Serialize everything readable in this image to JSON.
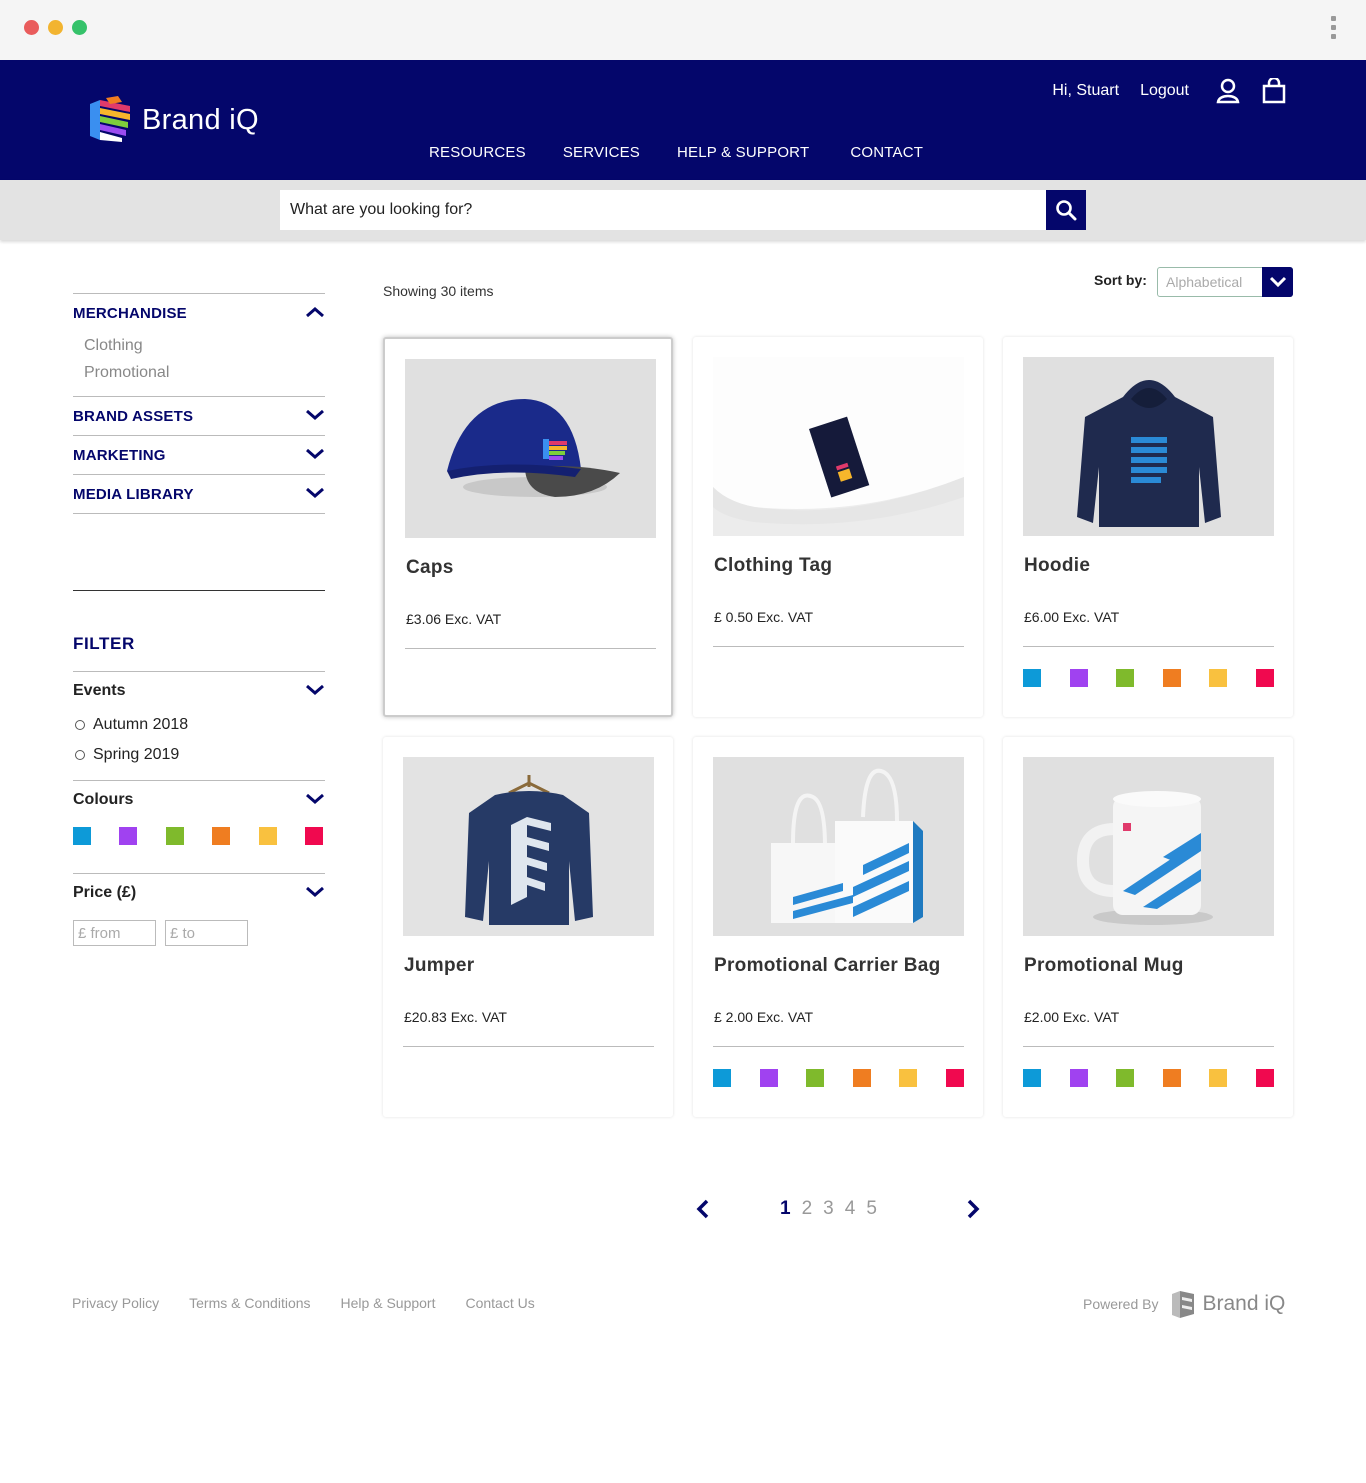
{
  "window": {
    "dots": [
      "#e95c5c",
      "#f2b430",
      "#35c26a"
    ]
  },
  "brand": {
    "name": "Brand iQ",
    "primary": "#04066b"
  },
  "nav": [
    {
      "label": "RESOURCES"
    },
    {
      "label": "SERVICES"
    },
    {
      "label": "HELP & SUPPORT"
    },
    {
      "label": "CONTACT"
    }
  ],
  "user": {
    "greeting": "Hi, Stuart",
    "logout": "Logout"
  },
  "search": {
    "placeholder": "What are you looking for?"
  },
  "sidebar": {
    "categories": [
      {
        "title": "MERCHANDISE",
        "expanded": true,
        "items": [
          "Clothing",
          "Promotional"
        ]
      },
      {
        "title": "BRAND ASSETS",
        "expanded": false
      },
      {
        "title": "MARKETING",
        "expanded": false
      },
      {
        "title": "MEDIA LIBRARY",
        "expanded": false
      }
    ],
    "filter_title": "FILTER",
    "events_title": "Events",
    "events": [
      "Autumn 2018",
      "Spring 2019"
    ],
    "colours_title": "Colours",
    "price_title": "Price (£)",
    "price_from_placeholder": "£ from",
    "price_to_placeholder": "£ to"
  },
  "colours": [
    "#0d9ad8",
    "#a042f0",
    "#7fba2c",
    "#ef7d21",
    "#f9c13f",
    "#f0094f"
  ],
  "listing": {
    "showing": "Showing 30 items",
    "sort_label": "Sort by:",
    "sort_value": "Alphabetical"
  },
  "products": [
    {
      "name": "Caps",
      "price": "£3.06 Exc. VAT",
      "has_colours": false,
      "active": true,
      "image": "cap"
    },
    {
      "name": "Clothing Tag",
      "price": "£ 0.50 Exc. VAT",
      "has_colours": false,
      "active": false,
      "image": "tag"
    },
    {
      "name": "Hoodie",
      "price": "£6.00 Exc. VAT",
      "has_colours": true,
      "active": false,
      "image": "hoodie"
    },
    {
      "name": "Jumper",
      "price": "£20.83 Exc. VAT",
      "has_colours": false,
      "active": false,
      "image": "jumper"
    },
    {
      "name": "Promotional Carrier Bag",
      "price": "£ 2.00 Exc. VAT",
      "has_colours": true,
      "active": false,
      "image": "bag"
    },
    {
      "name": "Promotional Mug",
      "price": "£2.00 Exc. VAT",
      "has_colours": true,
      "active": false,
      "image": "mug"
    }
  ],
  "pagination": {
    "pages": [
      "1",
      "2",
      "3",
      "4",
      "5"
    ],
    "current": "1"
  },
  "footer": {
    "links": [
      "Privacy Policy",
      "Terms & Conditions",
      "Help & Support",
      "Contact Us"
    ],
    "powered_by": "Powered By",
    "powered_brand": "Brand iQ"
  }
}
